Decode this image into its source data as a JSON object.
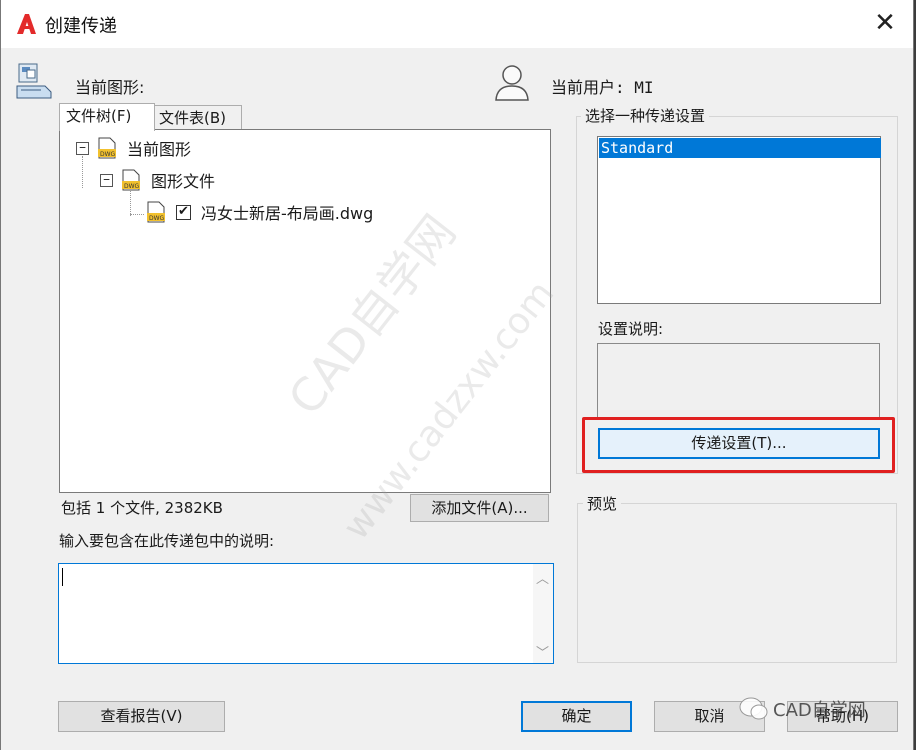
{
  "window": {
    "title": "创建传递",
    "close_symbol": "✕"
  },
  "header": {
    "current_drawing_label": "当前图形:",
    "current_user_label": "当前用户: MI"
  },
  "tabs": [
    {
      "label": "文件树(F)",
      "active": true
    },
    {
      "label": "文件表(B)",
      "active": false
    }
  ],
  "tree": {
    "root": {
      "label": "当前图形",
      "expander": "−"
    },
    "group": {
      "label": "图形文件",
      "expander": "−"
    },
    "file": {
      "label": "冯女士新居-布局画.dwg",
      "checked": true,
      "check_symbol": "✔"
    },
    "icon_text": "DWG"
  },
  "status": {
    "summary": "包括 1 个文件, 2382KB",
    "add_file_button": "添加文件(A)..."
  },
  "notes": {
    "label": "输入要包含在此传递包中的说明:",
    "value": "",
    "scroll_up": "︿",
    "scroll_down": "﹀"
  },
  "transmittal": {
    "group_label": "选择一种传递设置",
    "options": [
      "Standard"
    ],
    "selected": "Standard",
    "description_label": "设置说明:",
    "description_value": "",
    "setup_button": "传递设置(T)...",
    "highlight_color": "#e02020"
  },
  "preview": {
    "label": "预览"
  },
  "footer": {
    "view_report_button": "查看报告(V)",
    "ok_button": "确定",
    "cancel_button": "取消",
    "help_button": "帮助(H)"
  },
  "watermark": {
    "line1": "CAD自学网",
    "line2": "www.cadzxw.com",
    "wechat": "CAD自学网"
  },
  "colors": {
    "accent": "#0078d7",
    "app_icon_red": "#e32a2a"
  }
}
